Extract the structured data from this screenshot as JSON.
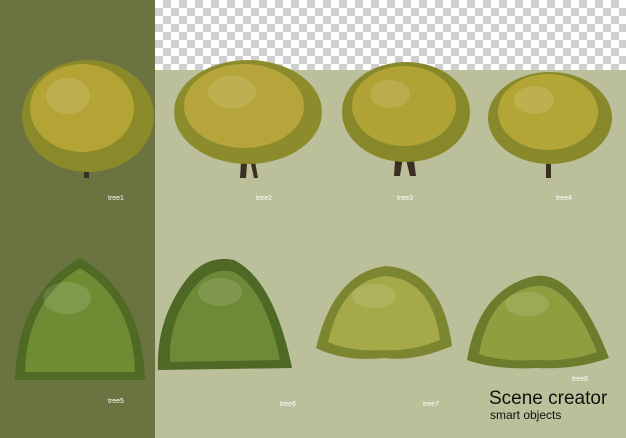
{
  "trees": [
    {
      "label": "tree1",
      "canopy": "#b4a436",
      "shade": "#8a8a2a"
    },
    {
      "label": "tree2",
      "canopy": "#b5a53a",
      "shade": "#8c8c2c"
    },
    {
      "label": "tree3",
      "canopy": "#b0a235",
      "shade": "#86882a"
    },
    {
      "label": "tree4",
      "canopy": "#b3a637",
      "shade": "#88892b"
    },
    {
      "label": "tree5",
      "canopy": "#6f8c34",
      "shade": "#4f6a24"
    },
    {
      "label": "tree6",
      "canopy": "#6e8a36",
      "shade": "#4e6826"
    },
    {
      "label": "tree7",
      "canopy": "#a6a948",
      "shade": "#7c852f"
    },
    {
      "label": "tree8",
      "canopy": "#8f9e3e",
      "shade": "#6b7c2c"
    }
  ],
  "brand": {
    "title": "Scene creator",
    "subtitle": "smart objects"
  },
  "colors": {
    "left_panel": "#6b7440",
    "background": "#bcc09a",
    "trunk": "#3a2f22"
  }
}
